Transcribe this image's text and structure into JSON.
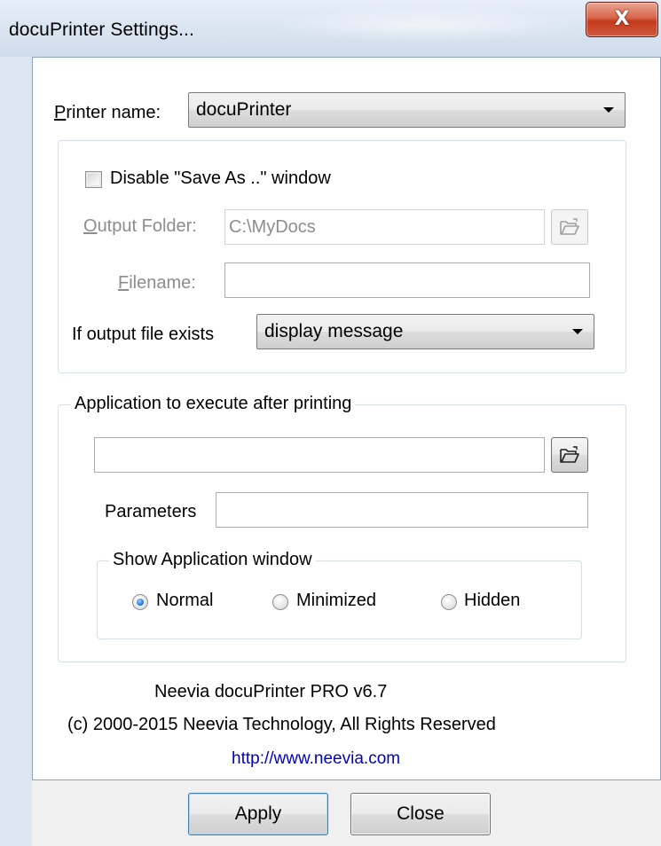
{
  "window": {
    "title": "docuPrinter Settings...",
    "close_glyph": "X"
  },
  "printer": {
    "label_accel": "P",
    "label_rest": "rinter name:",
    "selected": "docuPrinter"
  },
  "save_as": {
    "checkbox_label": "Disable \"Save As ..\" window",
    "checked": false,
    "output_folder_label_accel": "O",
    "output_folder_label_rest": "utput Folder:",
    "output_folder_value": "C:\\MyDocs",
    "filename_label_accel": "F",
    "filename_label_rest": "ilename:",
    "filename_value": "",
    "if_exists_label": "If output file exists",
    "if_exists_selected": "display message"
  },
  "application": {
    "group_caption": "Application to execute after printing",
    "path_value": "",
    "parameters_label": "Parameters",
    "parameters_value": "",
    "window_group_caption": "Show Application window",
    "window_options": [
      {
        "label": "Normal",
        "checked": true
      },
      {
        "label": "Minimized",
        "checked": false
      },
      {
        "label": "Hidden",
        "checked": false
      }
    ]
  },
  "about": {
    "product": "Neevia docuPrinter PRO v6.7",
    "copyright": "(c) 2000-2015 Neevia Technology, All Rights Reserved",
    "url": "http://www.neevia.com"
  },
  "buttons": {
    "apply": "Apply",
    "close": "Close"
  },
  "icons": {
    "browse": "folder-open-icon",
    "dropdown": "chevron-down-icon",
    "close": "close-icon"
  },
  "colors": {
    "link": "#0000c0",
    "disabled_text": "#8d8d8d",
    "close_button": "#c43a1d"
  }
}
